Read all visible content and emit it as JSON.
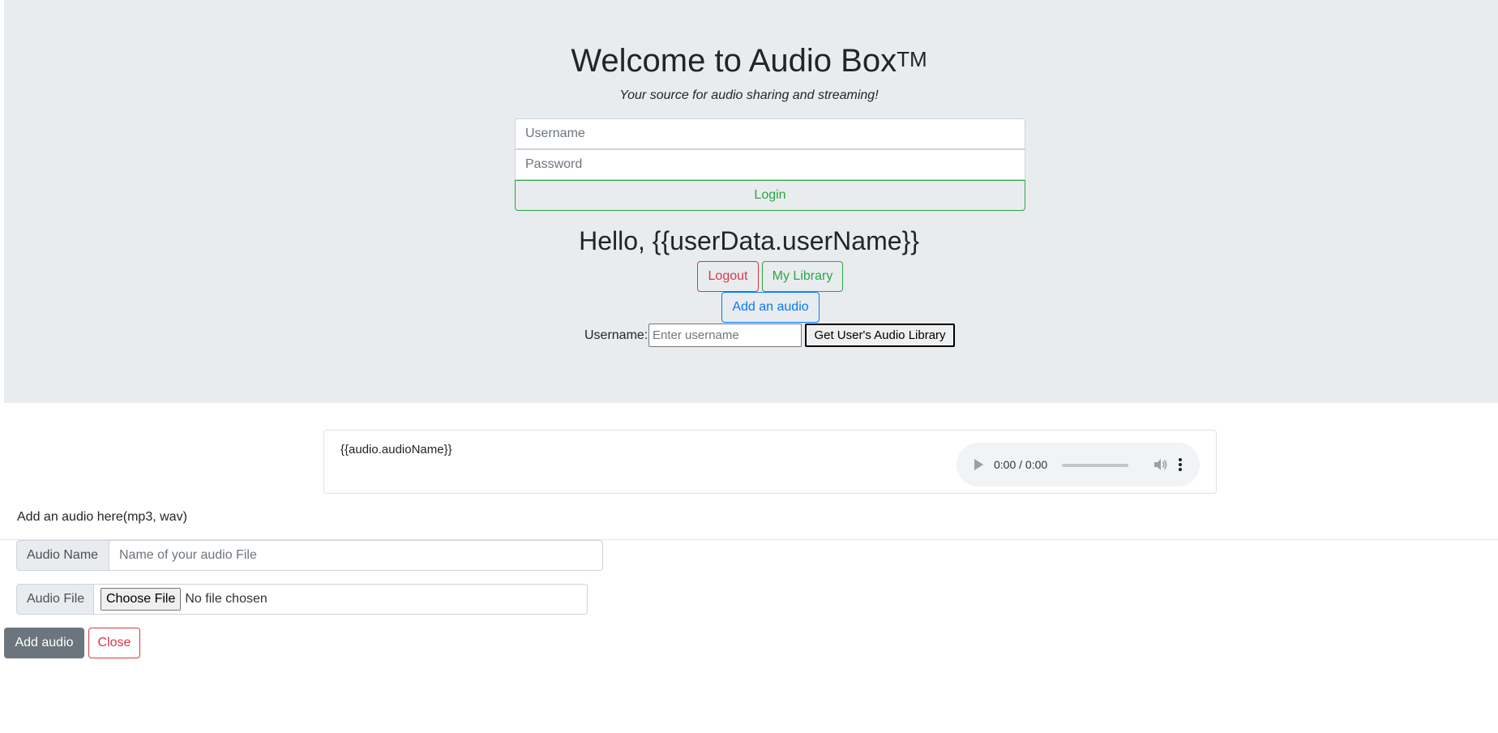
{
  "header": {
    "title": "Welcome to Audio Box",
    "trademark": "TM",
    "tagline": "Your source for audio sharing and streaming!"
  },
  "login": {
    "username_placeholder": "Username",
    "password_placeholder": "Password",
    "login_label": "Login"
  },
  "user": {
    "greeting": "Hello, {{userData.userName}}",
    "logout_label": "Logout",
    "library_label": "My Library",
    "add_audio_label": "Add an audio"
  },
  "lookup": {
    "label": "Username:",
    "placeholder": "Enter username",
    "button_label": "Get User's Audio Library"
  },
  "audio_card": {
    "name": "{{audio.audioName}}",
    "time": "0:00 / 0:00",
    "progress": 0
  },
  "add_form": {
    "header": "Add an audio here(mp3, wav)",
    "name_label": "Audio Name",
    "name_placeholder": "Name of your audio File",
    "file_label": "Audio File",
    "choose_label": "Choose File",
    "no_file_text": "No file chosen",
    "submit_label": "Add audio",
    "close_label": "Close"
  },
  "colors": {
    "jumbotron_bg": "#e9ecef",
    "success": "#28a745",
    "danger": "#dc3545",
    "primary": "#007bff",
    "secondary": "#6c757d"
  },
  "icons": [
    "play-icon",
    "volume-icon",
    "more-options-icon"
  ]
}
